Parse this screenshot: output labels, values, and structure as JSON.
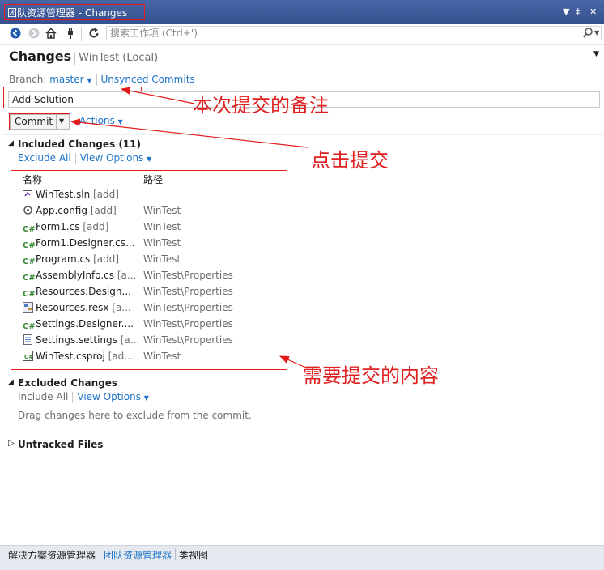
{
  "window": {
    "title": "团队资源管理器 - Changes"
  },
  "search": {
    "placeholder": "搜索工作项 (Ctrl+')"
  },
  "header": {
    "title": "Changes",
    "subtitle": "WinTest (Local)"
  },
  "branch": {
    "label": "Branch:",
    "value": "master",
    "unsynced_link": "Unsynced Commits"
  },
  "commit_message": {
    "value": "Add Solution"
  },
  "actions": {
    "commit_label": "Commit",
    "actions_label": "Actions"
  },
  "included": {
    "title": "Included Changes (11)",
    "exclude_all": "Exclude All",
    "view_options": "View Options",
    "columns": {
      "name": "名称",
      "path": "路径"
    },
    "files": [
      {
        "name": "WinTest.sln",
        "status": "[add]",
        "path": "",
        "icon": "solution-icon"
      },
      {
        "name": "App.config",
        "status": "[add]",
        "path": "WinTest",
        "icon": "config-icon"
      },
      {
        "name": "Form1.cs",
        "status": "[add]",
        "path": "WinTest",
        "icon": "csharp-icon"
      },
      {
        "name": "Form1.Designer.cs...",
        "status": "",
        "path": "WinTest",
        "icon": "csharp-icon"
      },
      {
        "name": "Program.cs",
        "status": "[add]",
        "path": "WinTest",
        "icon": "csharp-icon"
      },
      {
        "name": "AssemblyInfo.cs",
        "status": "[a...",
        "path": "WinTest\\Properties",
        "icon": "csharp-icon"
      },
      {
        "name": "Resources.Design...",
        "status": "",
        "path": "WinTest\\Properties",
        "icon": "csharp-icon"
      },
      {
        "name": "Resources.resx",
        "status": "[a...",
        "path": "WinTest\\Properties",
        "icon": "resx-icon"
      },
      {
        "name": "Settings.Designer....",
        "status": "",
        "path": "WinTest\\Properties",
        "icon": "csharp-icon"
      },
      {
        "name": "Settings.settings",
        "status": "[a...",
        "path": "WinTest\\Properties",
        "icon": "settings-icon"
      },
      {
        "name": "WinTest.csproj",
        "status": "[ad...",
        "path": "WinTest",
        "icon": "csproj-icon"
      }
    ]
  },
  "excluded": {
    "title": "Excluded Changes",
    "include_all": "Include All",
    "view_options": "View Options",
    "hint": "Drag changes here to exclude from the commit."
  },
  "untracked": {
    "title": "Untracked Files"
  },
  "annotations": {
    "commit_note": "本次提交的备注",
    "click_commit": "点击提交",
    "changes_content": "需要提交的内容"
  },
  "statusbar": {
    "tabs": [
      "解决方案资源管理器",
      "团队资源管理器",
      "类视图"
    ]
  },
  "colors": {
    "accent": "#1e74c8",
    "annotation": "#e21a1a",
    "titlebar": "#34508e"
  }
}
